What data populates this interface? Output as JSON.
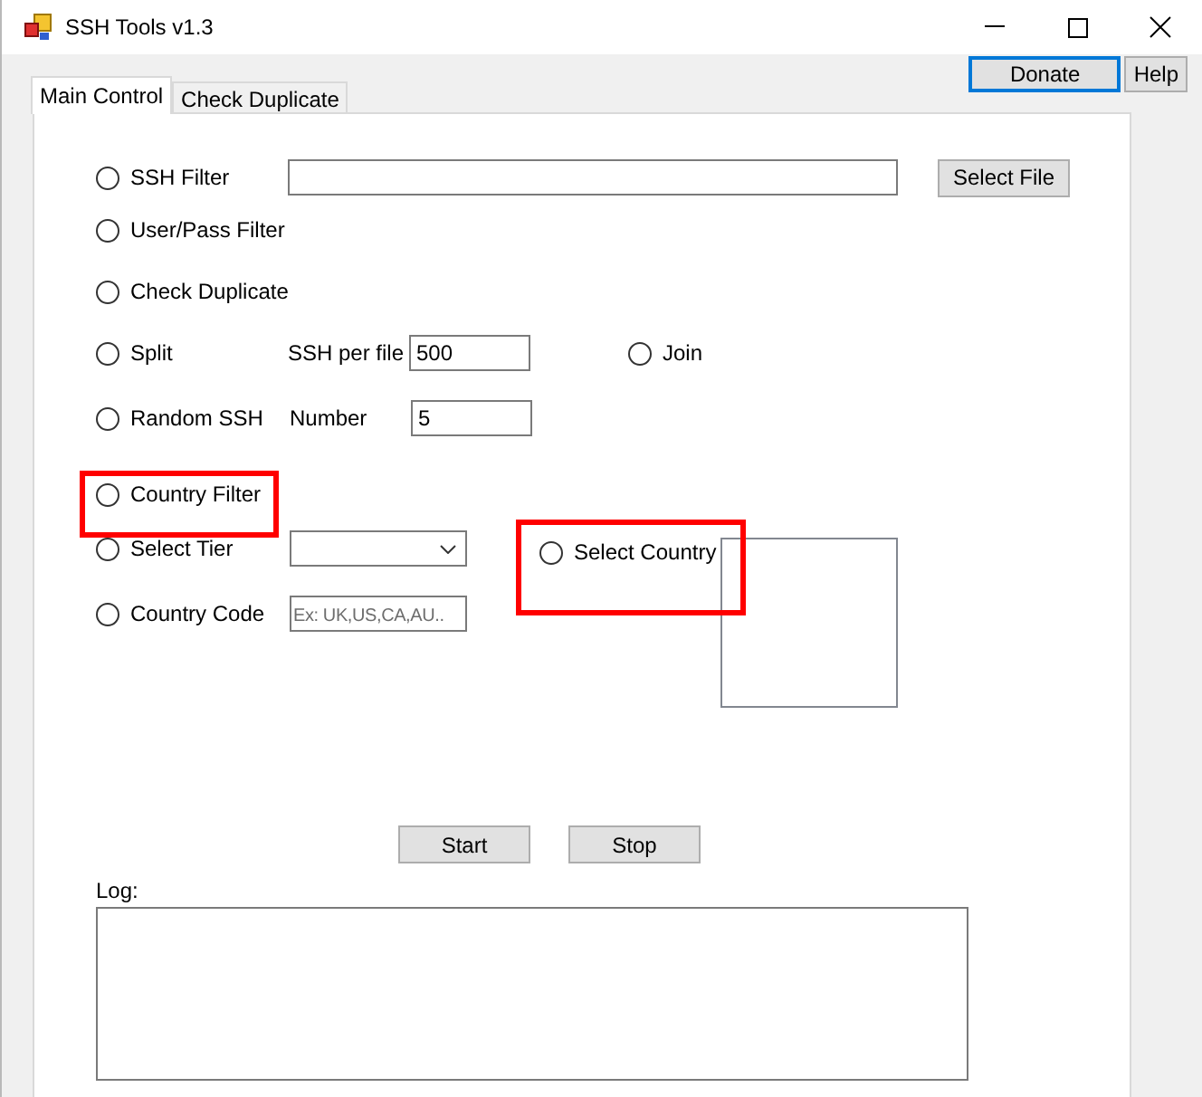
{
  "window": {
    "title": "SSH Tools v1.3"
  },
  "header_buttons": [
    {
      "label": "Donate",
      "focused": true
    },
    {
      "label": "Help",
      "focused": false
    }
  ],
  "tabs": [
    {
      "label": "Main Control",
      "selected": true
    },
    {
      "label": "Check Duplicate",
      "selected": false
    }
  ],
  "modes": [
    {
      "label": "SSH Filter",
      "selected": false,
      "highlighted": false
    },
    {
      "label": "User/Pass Filter",
      "selected": false,
      "highlighted": false
    },
    {
      "label": "Check Duplicate",
      "selected": false,
      "highlighted": false
    },
    {
      "label": "Split",
      "selected": false,
      "highlighted": false
    },
    {
      "label": "Join",
      "selected": false,
      "highlighted": false
    },
    {
      "label": "Random SSH",
      "selected": false,
      "highlighted": false
    },
    {
      "label": "Country Filter",
      "selected": false,
      "highlighted": true
    },
    {
      "label": "Select Tier",
      "selected": false,
      "highlighted": false
    },
    {
      "label": "Select Country",
      "selected": false,
      "highlighted": true
    },
    {
      "label": "Country Code",
      "selected": false,
      "highlighted": false
    }
  ],
  "select_file_button": "Select File",
  "split": {
    "label": "SSH per file",
    "value": "500"
  },
  "random": {
    "label": "Number",
    "value": "5"
  },
  "country_code": {
    "placeholder": "Ex: UK,US,CA,AU.."
  },
  "actions": [
    "Start",
    "Stop"
  ],
  "log": {
    "label": "Log:"
  }
}
